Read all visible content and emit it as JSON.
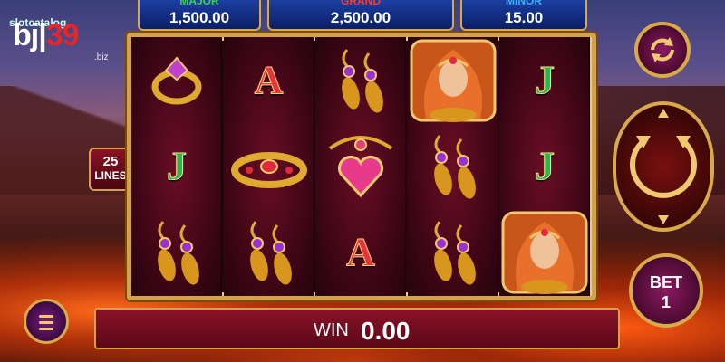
{
  "brand": {
    "top_text": "slotcatalog",
    "logo_main": "bj",
    "logo_num": "39",
    "logo_sub": ".biz"
  },
  "jackpots": [
    {
      "label": "MAJOR",
      "value": "1,500.00",
      "color": "#3ad35a"
    },
    {
      "label": "GRAND",
      "value": "2,500.00",
      "color": "#ff3a2a"
    },
    {
      "label": "MINOR",
      "value": "15.00",
      "color": "#3ab0ff"
    }
  ],
  "lines": {
    "count": "25",
    "label": "LINES"
  },
  "reels": [
    [
      "ring-symbol",
      "J",
      "earrings-symbol"
    ],
    [
      "A",
      "crown-symbol",
      "earrings-symbol"
    ],
    [
      "earrings-symbol",
      "heart-necklace-symbol",
      "A"
    ],
    [
      "queen-wild-symbol",
      "earrings-symbol",
      "earrings-symbol"
    ],
    [
      "J",
      "J",
      "queen-wild-symbol"
    ]
  ],
  "win": {
    "label": "WIN",
    "value": "0.00"
  },
  "bet": {
    "label": "BET",
    "value": "1"
  },
  "icons": {
    "refresh": "refresh-icon",
    "spin": "spin-icon",
    "menu": "menu-icon"
  }
}
